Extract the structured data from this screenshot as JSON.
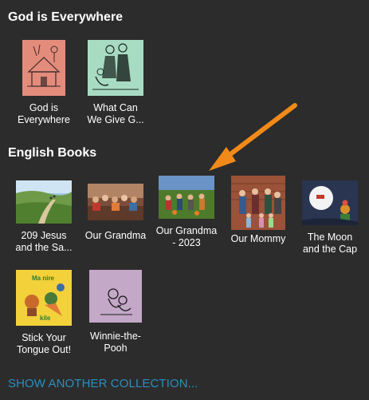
{
  "sections": [
    {
      "title": "God is Everywhere",
      "books": [
        {
          "title": "God is Everywhere",
          "line1": "God is",
          "line2": "Everywhere"
        },
        {
          "title": "What Can We Give G...",
          "line1": "What Can",
          "line2": "We Give G..."
        }
      ]
    },
    {
      "title": "English Books",
      "books": [
        {
          "title": "209 Jesus and the Sa...",
          "line1": "209 Jesus",
          "line2": "and the Sa..."
        },
        {
          "title": "Our Grandma",
          "line1": "Our Grandma",
          "line2": ""
        },
        {
          "title": "Our Grandma - 2023",
          "line1": "Our Grandma",
          "line2": "- 2023"
        },
        {
          "title": "Our Mommy",
          "line1": "Our Mommy",
          "line2": ""
        },
        {
          "title": "The Moon and the Cap",
          "line1": "The Moon",
          "line2": "and the Cap"
        },
        {
          "title": "Stick Your Tongue Out!",
          "line1": "Stick Your",
          "line2": "Tongue Out!",
          "cover_top": "Ma nire",
          "cover_bottom": "kile"
        },
        {
          "title": "Winnie-the-Pooh",
          "line1": "Winnie-the-",
          "line2": "Pooh"
        }
      ]
    }
  ],
  "show_another": "SHOW ANOTHER COLLECTION...",
  "colors": {
    "background": "#2c2c2c",
    "link": "#2a8fbd",
    "arrow": "#f28a1a"
  }
}
